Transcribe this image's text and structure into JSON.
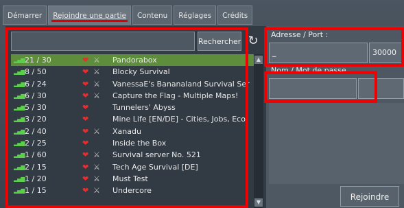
{
  "tabs": [
    {
      "label": "Démarrer"
    },
    {
      "label": "Rejoindre une partie"
    },
    {
      "label": "Contenu"
    },
    {
      "label": "Réglages"
    },
    {
      "label": "Crédits"
    }
  ],
  "search": {
    "value": "",
    "button_label": "Rechercher",
    "refresh_icon": "refresh-icon"
  },
  "servers": [
    {
      "clients": "21 / 30",
      "heart": true,
      "pvp": true,
      "name": "Pandorabox"
    },
    {
      "clients": "8 / 50",
      "heart": true,
      "pvp": true,
      "name": "Blocky Survival"
    },
    {
      "clients": "6 / 24",
      "heart": true,
      "pvp": true,
      "name": "VanessaE's Bananaland Survival Ser"
    },
    {
      "clients": "6 / 30",
      "heart": true,
      "pvp": true,
      "name": "Capture the Flag - Multiple Maps!"
    },
    {
      "clients": "5 / 30",
      "heart": true,
      "pvp": false,
      "name": "Tunnelers' Abyss"
    },
    {
      "clients": "3 / 20",
      "heart": true,
      "pvp": false,
      "name": "Mine Life [EN/DE] - Cities, Jobs, Eco"
    },
    {
      "clients": "2 / 40",
      "heart": true,
      "pvp": true,
      "name": "Xanadu"
    },
    {
      "clients": "2 / 25",
      "heart": true,
      "pvp": false,
      "name": "Inside the Box"
    },
    {
      "clients": "1 / 60",
      "heart": true,
      "pvp": true,
      "name": "Survival server No. 521"
    },
    {
      "clients": "2 / 15",
      "heart": true,
      "pvp": true,
      "name": "Tech Age Survival [DE]"
    },
    {
      "clients": "1 / 20",
      "heart": true,
      "pvp": true,
      "name": "Must Test"
    },
    {
      "clients": "1 / 15",
      "heart": true,
      "pvp": true,
      "name": "Undercore"
    }
  ],
  "address": {
    "label": "Adresse / Port :",
    "address_value": "_",
    "port_value": "30000"
  },
  "credentials": {
    "label": "Nom / Mot de passe",
    "name_value": "",
    "password_value": ""
  },
  "join_button": "Rejoindre",
  "colors": {
    "highlight_red": "#f00000",
    "selected_row": "#5e8d3b",
    "heart": "#ef2a2a",
    "signal": "#5bd04a"
  }
}
